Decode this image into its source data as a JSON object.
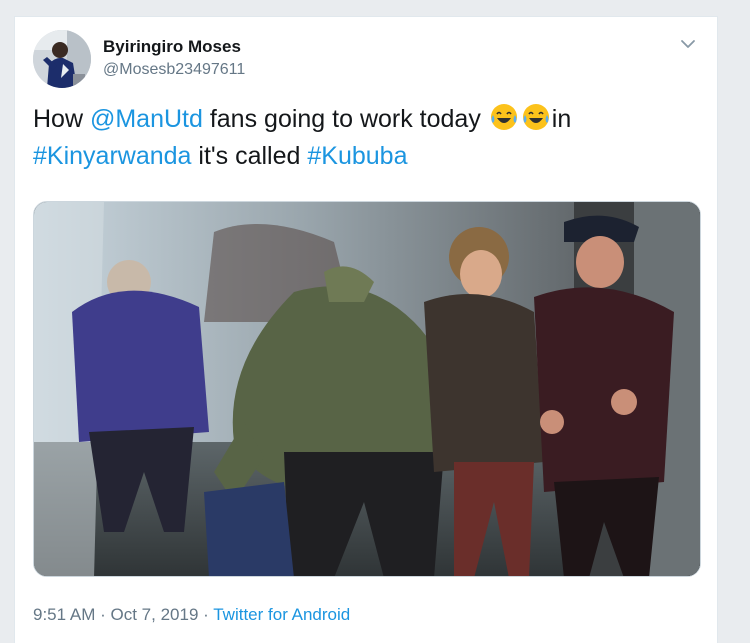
{
  "tweet": {
    "display_name": "Byiringiro Moses",
    "handle": "@Mosesb23497611",
    "text": {
      "part1": "How ",
      "mention": "@ManUtd",
      "part2": " fans going to work today ",
      "emoji_1": "😂",
      "emoji_2": "😂",
      "part3": "in",
      "hashtag_1": "#Kinyarwanda",
      "part4": " it's called ",
      "hashtag_2": "#Kububa"
    },
    "time": "9:51 AM",
    "date": "Oct 7, 2019",
    "separator": "·",
    "source": "Twitter for Android"
  },
  "icons": {
    "menu": "chevron-down-icon",
    "emoji": "face-with-tears-of-joy-icon"
  },
  "colors": {
    "link": "#1b95e0",
    "text": "#14171a",
    "muted": "#657786",
    "emoji_face": "#fcc21b"
  }
}
